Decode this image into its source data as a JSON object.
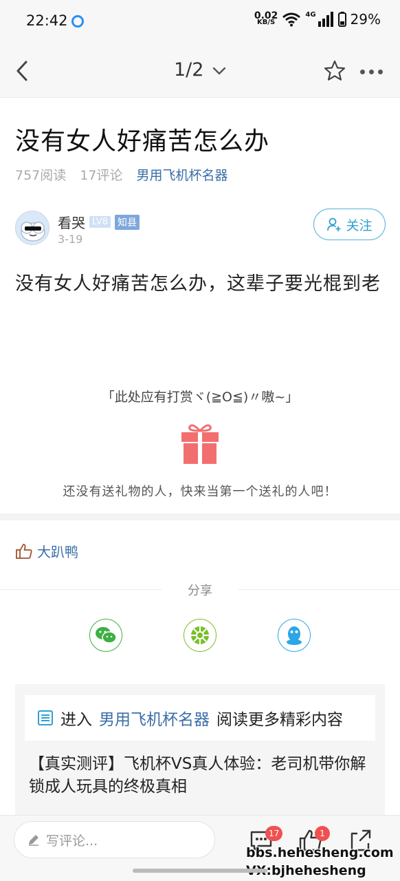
{
  "status_bar": {
    "time": "22:42",
    "net_speed_value": "0.02",
    "net_speed_unit": "KB/S",
    "network": "4G",
    "battery": "29%"
  },
  "nav": {
    "pager": "1/2"
  },
  "post": {
    "title": "没有女人好痛苦怎么办",
    "reads": "757阅读",
    "comments": "17评论",
    "category": "男用飞机杯名器",
    "author": {
      "name": "看哭",
      "level": "LV8",
      "rank": "知县",
      "date": "3-19"
    },
    "follow_label": "关注",
    "content": "没有女人好痛苦怎么办，这辈子要光棍到老"
  },
  "reward": {
    "hint": "「此处应有打赏ヾ(≧O≦)〃嗷~」",
    "empty_text": "还没有送礼物的人，快来当第一个送礼的人吧！"
  },
  "likes": {
    "user": "大趴鸭"
  },
  "share": {
    "label": "分享"
  },
  "recommend": {
    "prefix": "进入",
    "category": "男用飞机杯名器",
    "suffix": "阅读更多精彩内容",
    "article": "【真实测评】飞机杯VS真人体验：老司机带你解锁成人玩具的终极真相"
  },
  "bottom_bar": {
    "comment_placeholder": "写评论...",
    "comment_count": "17",
    "like_count": "1"
  },
  "watermark": {
    "line1": "bbs.hehesheng.com",
    "line2": "VX:bjhehesheng"
  },
  "colors": {
    "link": "#3a6ea8",
    "follow": "#2fa0cf",
    "gift": "#f26f6f",
    "badge": "#f15050",
    "wechat": "#3cb043",
    "moments": "#7bbf2a",
    "qq": "#2ba6e6"
  }
}
